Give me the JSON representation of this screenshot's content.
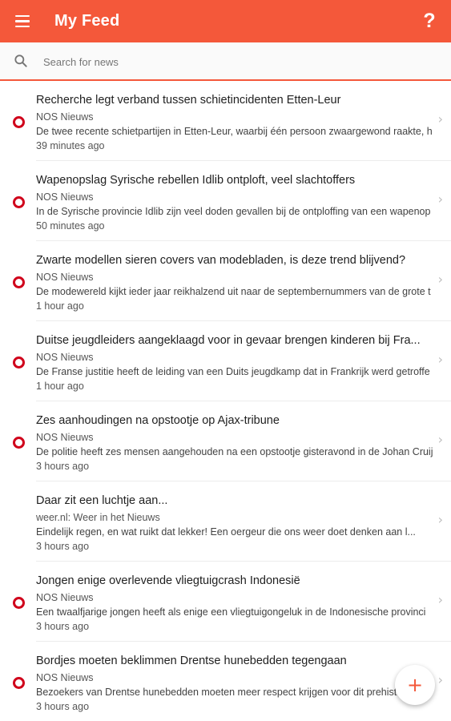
{
  "app": {
    "title": "My Feed",
    "menu_icon": "hamburger-menu-icon",
    "help_icon": "question-mark-icon",
    "help_glyph": "?",
    "accent_color": "#f4583a",
    "unread_dot_color": "#d0021b"
  },
  "search": {
    "placeholder": "Search for news",
    "value": "",
    "icon": "search-icon"
  },
  "feed": {
    "items": [
      {
        "title": "Recherche legt verband tussen schietincidenten Etten-Leur",
        "source": "NOS Nieuws",
        "snippet": "De twee recente schietpartijen in Etten-Leur, waarbij één persoon zwaargewond raakte, h",
        "time": "39 minutes ago",
        "unread": true
      },
      {
        "title": "Wapenopslag Syrische rebellen Idlib ontploft, veel slachtoffers",
        "source": "NOS Nieuws",
        "snippet": "In de Syrische provincie Idlib zijn veel doden gevallen bij de ontploffing van een wapenop",
        "time": "50 minutes ago",
        "unread": true
      },
      {
        "title": "Zwarte modellen sieren covers van modebladen, is deze trend blijvend?",
        "source": "NOS Nieuws",
        "snippet": "De modewereld kijkt ieder jaar reikhalzend uit naar de septembernummers van de grote t",
        "time": "1 hour ago",
        "unread": true
      },
      {
        "title": "Duitse jeugdleiders aangeklaagd voor in gevaar brengen kinderen bij Fra...",
        "source": "NOS Nieuws",
        "snippet": "De Franse justitie heeft de leiding van een Duits jeugdkamp dat in Frankrijk werd getroffe",
        "time": "1 hour ago",
        "unread": true
      },
      {
        "title": "Zes aanhoudingen na opstootje op Ajax-tribune",
        "source": "NOS Nieuws",
        "snippet": "De politie heeft zes mensen aangehouden na een opstootje gisteravond in de Johan Cruij",
        "time": "3 hours ago",
        "unread": true
      },
      {
        "title": "Daar zit een luchtje aan...",
        "source": "weer.nl: Weer in het Nieuws",
        "snippet": "Eindelijk regen, en wat ruikt dat lekker! Een oergeur die ons weer doet denken aan l...",
        "time": "3 hours ago",
        "unread": false
      },
      {
        "title": "Jongen enige overlevende vliegtuigcrash Indonesië",
        "source": "NOS Nieuws",
        "snippet": "Een twaalfjarige jongen heeft als enige een vliegtuigongeluk in de Indonesische provinci",
        "time": "3 hours ago",
        "unread": true
      },
      {
        "title": "Bordjes moeten beklimmen Drentse hunebedden tegengaan",
        "source": "NOS Nieuws",
        "snippet": "Bezoekers van Drentse hunebedden moeten meer respect krijgen voor dit prehistorische",
        "time": "3 hours ago",
        "unread": true
      }
    ]
  },
  "fab": {
    "icon": "plus-icon",
    "glyph": "+"
  }
}
